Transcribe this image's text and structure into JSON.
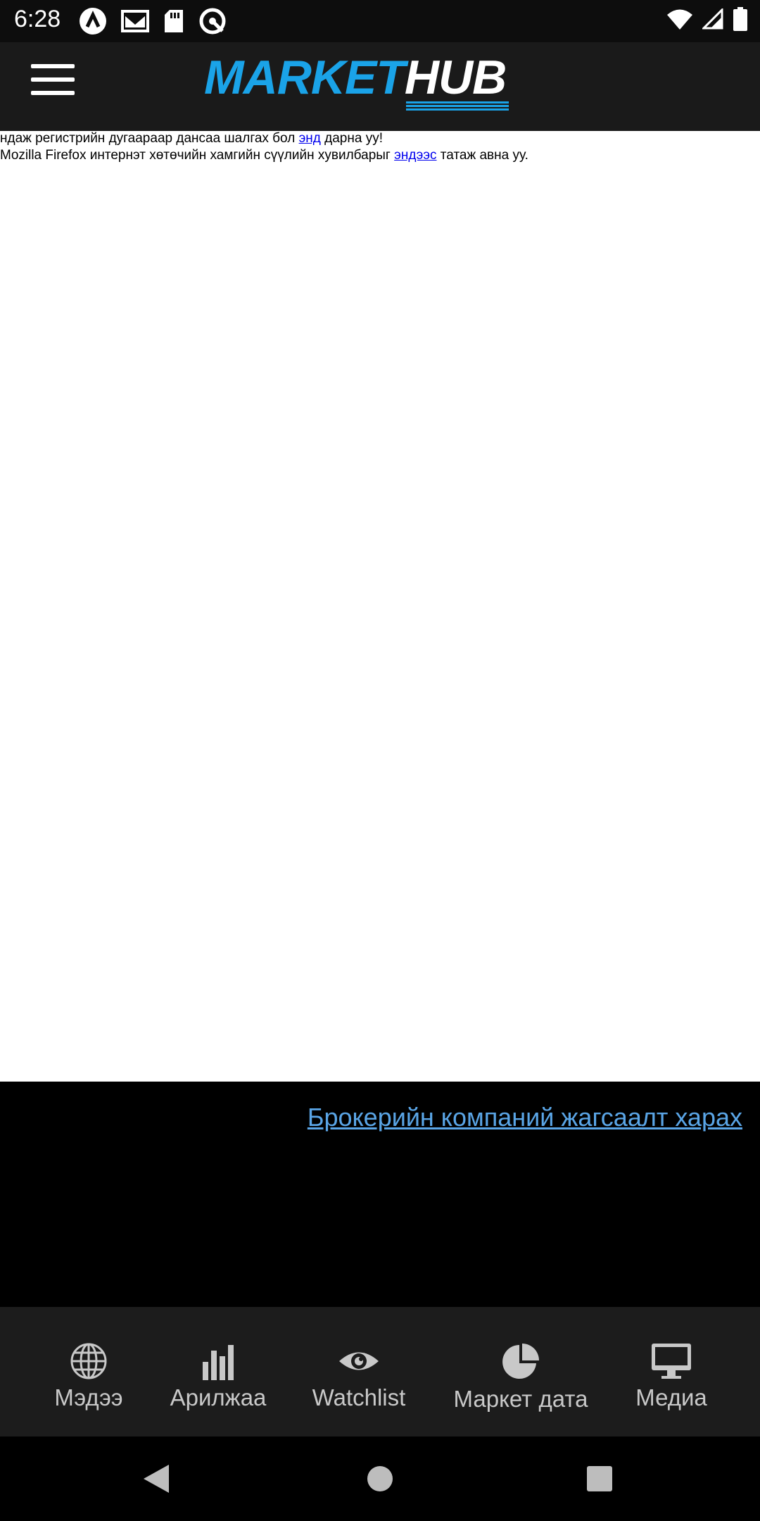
{
  "status_bar": {
    "time": "6:28",
    "left_icons": [
      "app-notification-icon",
      "mail-icon",
      "sd-card-icon",
      "sync-icon"
    ],
    "right_icons": [
      "wifi-icon",
      "signal-icon",
      "battery-icon"
    ]
  },
  "header": {
    "logo_part1": "MARKET",
    "logo_part2": "HUB",
    "brand_color": "#1aa3e8"
  },
  "content": {
    "line1_before": "ндаж регистрийн дугаараар дансаа шалгах бол ",
    "line1_link": "энд",
    "line1_after": " дарна уу!",
    "line2_before": " Mozilla Firefox интернэт хөтөчийн хамгийн сүүлийн хувилбарыг ",
    "line2_link": "эндээс",
    "line2_after": " татаж авна уу."
  },
  "broker_link": "Брокерийн компаний жагсаалт харах",
  "bottom_nav": {
    "items": [
      {
        "label": "Мэдээ",
        "icon": "globe-icon"
      },
      {
        "label": "Арилжаа",
        "icon": "bar-chart-icon"
      },
      {
        "label": "Watchlist",
        "icon": "eye-icon"
      },
      {
        "label": "Маркет дата",
        "icon": "pie-chart-icon"
      },
      {
        "label": "Медиа",
        "icon": "monitor-icon"
      }
    ]
  },
  "system_nav": [
    "back-icon",
    "home-icon",
    "recents-icon"
  ]
}
